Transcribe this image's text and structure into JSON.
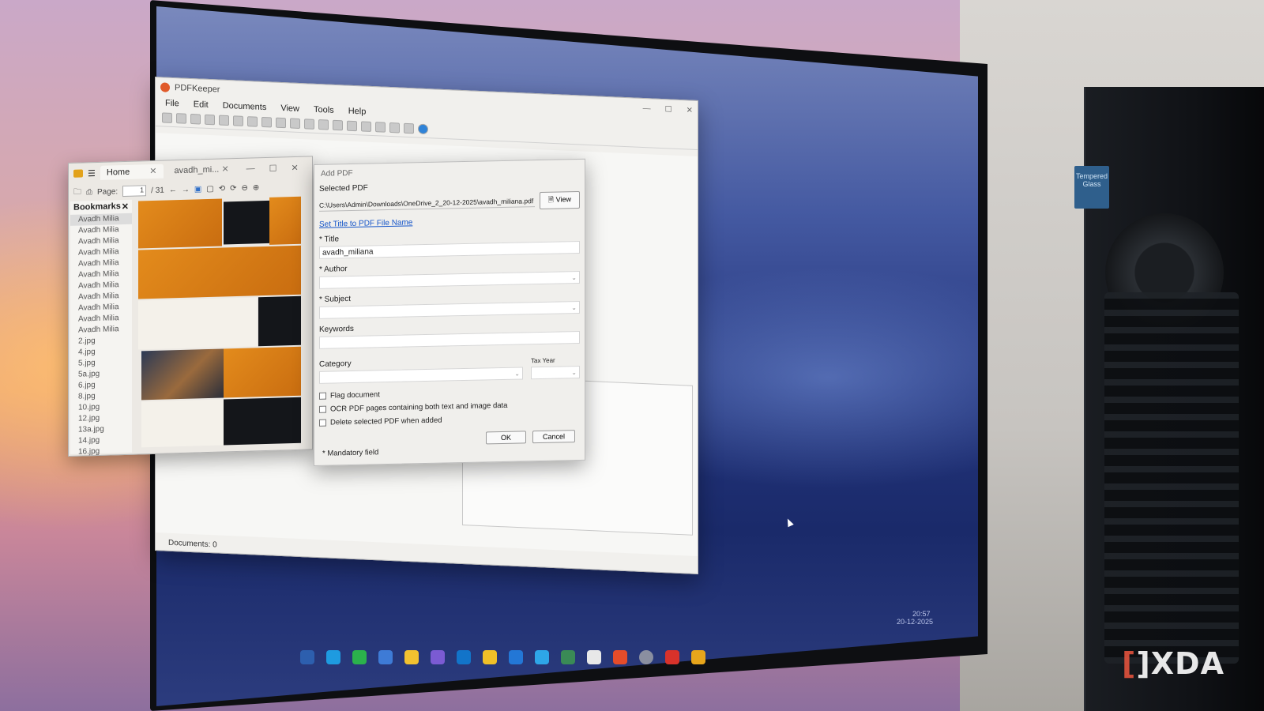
{
  "main_window": {
    "title": "PDFKeeper",
    "menu": [
      "File",
      "Edit",
      "Documents",
      "View",
      "Tools",
      "Help"
    ],
    "status": "Documents: 0"
  },
  "viewer": {
    "tab_home": "Home",
    "tab_doc": "avadh_mi...",
    "page_label": "Page:",
    "page_value": "1",
    "page_total": "/ 31",
    "bookmarks_title": "Bookmarks",
    "bookmarks": [
      "Avadh Milia",
      "Avadh Milia",
      "Avadh Milia",
      "Avadh Milia",
      "Avadh Milia",
      "Avadh Milia",
      "Avadh Milia",
      "Avadh Milia",
      "Avadh Milia",
      "Avadh Milia",
      "Avadh Milia",
      "2.jpg",
      "4.jpg",
      "5.jpg",
      "5a.jpg",
      "6.jpg",
      "8.jpg",
      "10.jpg",
      "12.jpg",
      "13a.jpg",
      "14.jpg",
      "16.jpg"
    ]
  },
  "dialog": {
    "title": "Add PDF",
    "selected_label": "Selected PDF",
    "path": "C:\\Users\\Admin\\Downloads\\OneDrive_2_20-12-2025\\avadh_miliana.pdf",
    "view_button": "View",
    "set_title_link": "Set Title to PDF File Name",
    "title_label": "* Title",
    "title_value": "avadh_miliana",
    "author_label": "* Author",
    "subject_label": "* Subject",
    "keywords_label": "Keywords",
    "category_label": "Category",
    "tax_year_label": "Tax Year",
    "flag_label": "Flag document",
    "ocr_label": "OCR PDF pages containing both text and image data",
    "delete_label": "Delete selected PDF when added",
    "ok": "OK",
    "cancel": "Cancel",
    "mandatory": "* Mandatory field"
  },
  "tray": {
    "time": "20:57",
    "date": "20-12-2025"
  },
  "case_badge": "Tempered Glass",
  "watermark": "XDA",
  "icons": [
    "app-icon",
    "menu-icon",
    "close-icon",
    "minimize-icon",
    "maximize-icon",
    "folder-icon",
    "print-icon",
    "back-arrow-icon",
    "forward-arrow-icon",
    "zoom-icon",
    "help-icon",
    "view-icon",
    "chevron-down-icon"
  ],
  "colors": {
    "accent_link": "#1656c9",
    "brand_orange": "#e38b1c",
    "desktop_blue": "#23347c"
  }
}
